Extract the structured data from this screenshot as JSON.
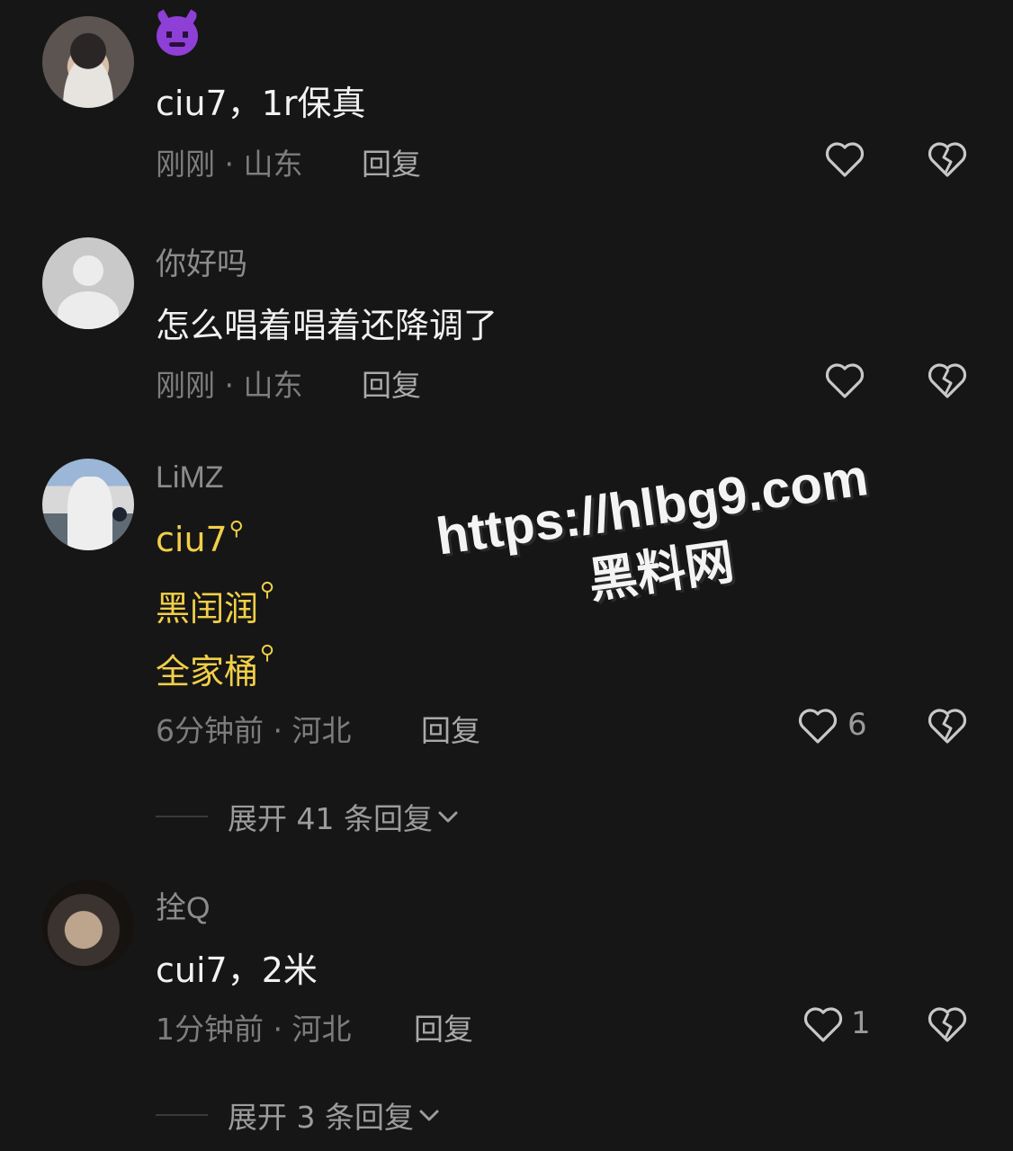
{
  "comments": [
    {
      "avatar": "user-photo",
      "username_emoji": "devil-emoji",
      "text": "ciu7，1r保真",
      "time": "刚刚",
      "location": "山东",
      "reply_label": "回复"
    },
    {
      "avatar": "default-avatar",
      "username": "你好吗",
      "text": "怎么唱着唱着还降调了",
      "time": "刚刚",
      "location": "山东",
      "reply_label": "回复"
    },
    {
      "avatar": "user-photo",
      "username": "LiMZ",
      "tags": [
        "ciu7",
        "黑闰润",
        "全家桶"
      ],
      "time": "6分钟前",
      "location": "河北",
      "reply_label": "回复",
      "likes": "6",
      "expand_label": "展开 41 条回复"
    },
    {
      "avatar": "user-photo",
      "username": "拴Q",
      "text": "cui7，2米",
      "time": "1分钟前",
      "location": "河北",
      "reply_label": "回复",
      "likes": "1",
      "expand_label": "展开 3 条回复"
    }
  ],
  "meta_separator": "·",
  "watermark": {
    "url": "https://hlbg9.com",
    "name": "黑料网"
  },
  "colors": {
    "background": "#161616",
    "tag_yellow": "#f1cf48"
  },
  "icons": [
    "heart-outline-icon",
    "broken-heart-icon",
    "search-icon",
    "chevron-down-icon"
  ]
}
